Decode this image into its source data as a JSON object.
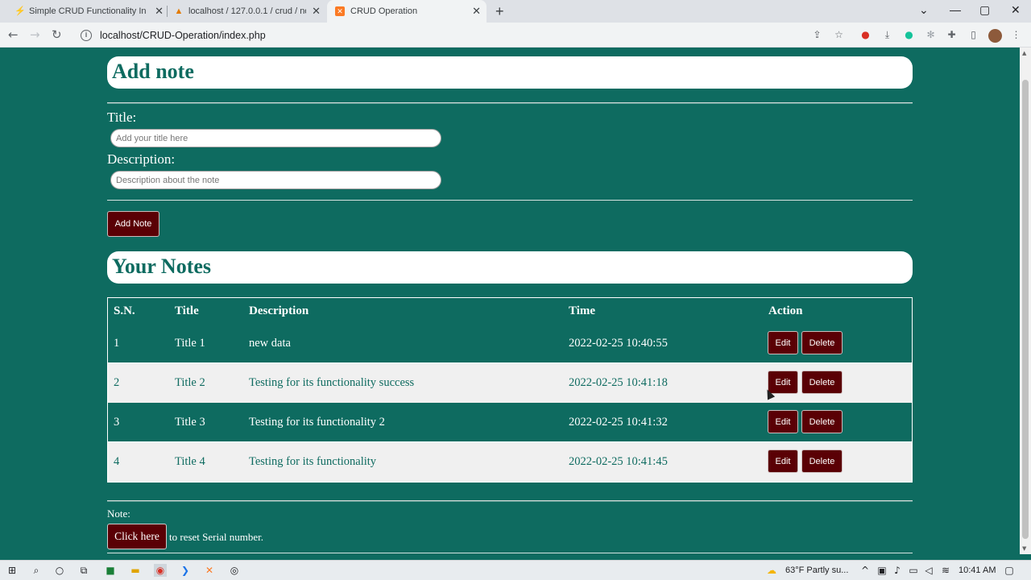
{
  "browser": {
    "tabs": [
      {
        "title": "Simple CRUD Functionality In PH",
        "icon": "php-icon"
      },
      {
        "title": "localhost / 127.0.0.1 / crud / note",
        "icon": "phpmyadmin-icon"
      },
      {
        "title": "CRUD Operation",
        "icon": "xampp-icon",
        "active": true
      }
    ],
    "url": "localhost/CRUD-Operation/index.php"
  },
  "form": {
    "heading": "Add note",
    "title_label": "Title:",
    "title_placeholder": "Add your title here",
    "title_value": "",
    "description_label": "Description:",
    "description_placeholder": "Description about the note",
    "description_value": "",
    "submit_label": "Add Note"
  },
  "notes": {
    "heading": "Your Notes",
    "columns": [
      "S.N.",
      "Title",
      "Description",
      "Time",
      "Action"
    ],
    "rows": [
      {
        "sn": "1",
        "title": "Title 1",
        "description": "new data",
        "time": "2022-02-25 10:40:55"
      },
      {
        "sn": "2",
        "title": "Title 2",
        "description": "Testing for its functionality success",
        "time": "2022-02-25 10:41:18"
      },
      {
        "sn": "3",
        "title": "Title 3",
        "description": "Testing for its functionality 2",
        "time": "2022-02-25 10:41:32"
      },
      {
        "sn": "4",
        "title": "Title 4",
        "description": "Testing for its functionality",
        "time": "2022-02-25 10:41:45"
      }
    ],
    "edit_label": "Edit",
    "delete_label": "Delete"
  },
  "footer": {
    "note_label": "Note:",
    "click_here_label": "Click here",
    "reset_text": "to reset Serial number."
  },
  "taskbar": {
    "weather": "63°F  Partly su...",
    "time": "10:41 AM"
  },
  "colors": {
    "page_background": "#0e6b60",
    "button": "#5a0005",
    "row_light": "#f0f0f0"
  }
}
